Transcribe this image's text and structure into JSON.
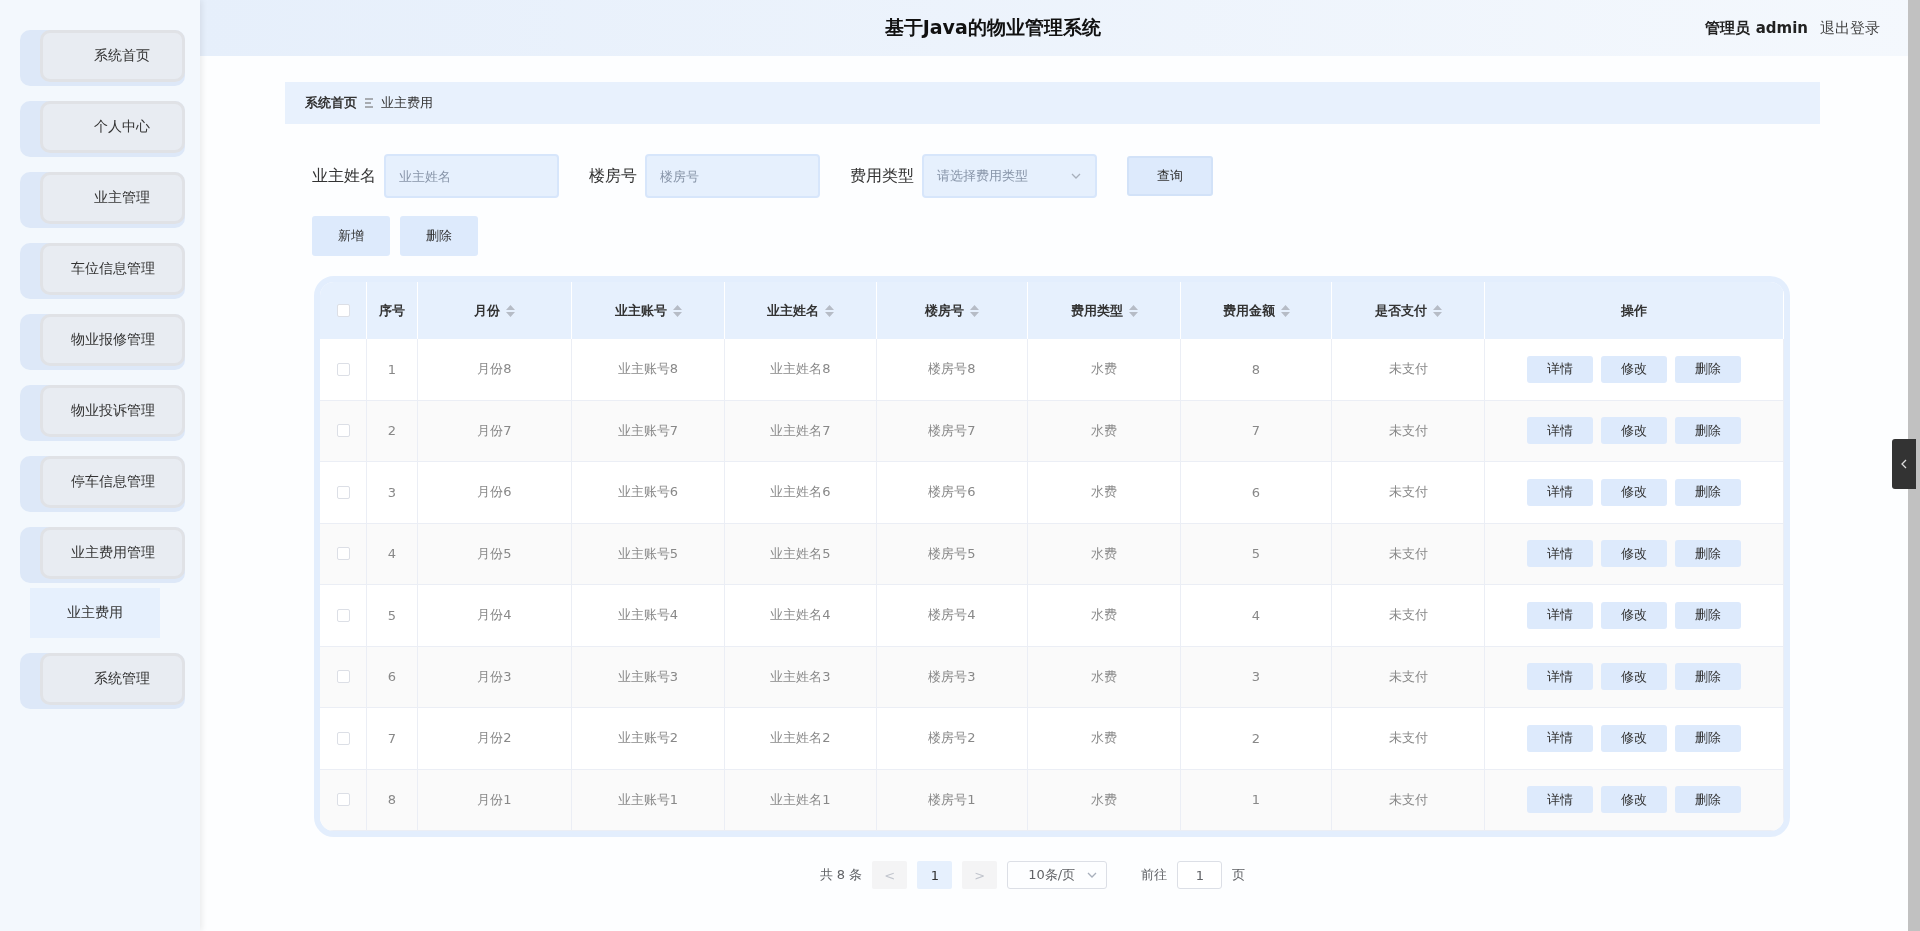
{
  "header": {
    "title": "基于Java的物业管理系统",
    "user": "管理员 admin",
    "logout": "退出登录"
  },
  "sidebar": {
    "items": [
      {
        "label": "系统首页"
      },
      {
        "label": "个人中心"
      },
      {
        "label": "业主管理"
      },
      {
        "label": "车位信息管理"
      },
      {
        "label": "物业报修管理"
      },
      {
        "label": "物业投诉管理"
      },
      {
        "label": "停车信息管理"
      },
      {
        "label": "业主费用管理",
        "children": [
          {
            "label": "业主费用",
            "selected": true
          }
        ]
      },
      {
        "label": "系统管理"
      }
    ]
  },
  "breadcrumb": [
    {
      "label": "系统首页"
    },
    {
      "label": "业主费用"
    }
  ],
  "filters": [
    {
      "kind": "input",
      "label": "业主姓名",
      "placeholder": "业主姓名"
    },
    {
      "kind": "input",
      "label": "楼房号",
      "placeholder": "楼房号"
    },
    {
      "kind": "select",
      "label": "费用类型",
      "placeholder": "请选择费用类型"
    }
  ],
  "search_button": "查询",
  "actions": [
    "新增",
    "删除"
  ],
  "table": {
    "all_checked": false,
    "columns": [
      {
        "label": "序号",
        "sortable": false
      },
      {
        "label": "月份",
        "sortable": true
      },
      {
        "label": "业主账号",
        "sortable": true
      },
      {
        "label": "业主姓名",
        "sortable": true
      },
      {
        "label": "楼房号",
        "sortable": true
      },
      {
        "label": "费用类型",
        "sortable": true
      },
      {
        "label": "费用金额",
        "sortable": true
      },
      {
        "label": "是否支付",
        "sortable": true
      },
      {
        "label": "操作",
        "sortable": false
      }
    ],
    "rows": [
      {
        "checked": false,
        "cells": [
          "1",
          "月份8",
          "业主账号8",
          "业主姓名8",
          "楼房号8",
          "水费",
          "8",
          "未支付"
        ],
        "actions": [
          "详情",
          "修改",
          "删除"
        ]
      },
      {
        "checked": false,
        "cells": [
          "2",
          "月份7",
          "业主账号7",
          "业主姓名7",
          "楼房号7",
          "水费",
          "7",
          "未支付"
        ],
        "actions": [
          "详情",
          "修改",
          "删除"
        ]
      },
      {
        "checked": false,
        "cells": [
          "3",
          "月份6",
          "业主账号6",
          "业主姓名6",
          "楼房号6",
          "水费",
          "6",
          "未支付"
        ],
        "actions": [
          "详情",
          "修改",
          "删除"
        ]
      },
      {
        "checked": false,
        "cells": [
          "4",
          "月份5",
          "业主账号5",
          "业主姓名5",
          "楼房号5",
          "水费",
          "5",
          "未支付"
        ],
        "actions": [
          "详情",
          "修改",
          "删除"
        ]
      },
      {
        "checked": false,
        "cells": [
          "5",
          "月份4",
          "业主账号4",
          "业主姓名4",
          "楼房号4",
          "水费",
          "4",
          "未支付"
        ],
        "actions": [
          "详情",
          "修改",
          "删除"
        ]
      },
      {
        "checked": false,
        "cells": [
          "6",
          "月份3",
          "业主账号3",
          "业主姓名3",
          "楼房号3",
          "水费",
          "3",
          "未支付"
        ],
        "actions": [
          "详情",
          "修改",
          "删除"
        ]
      },
      {
        "checked": false,
        "cells": [
          "7",
          "月份2",
          "业主账号2",
          "业主姓名2",
          "楼房号2",
          "水费",
          "2",
          "未支付"
        ],
        "actions": [
          "详情",
          "修改",
          "删除"
        ]
      },
      {
        "checked": false,
        "cells": [
          "8",
          "月份1",
          "业主账号1",
          "业主姓名1",
          "楼房号1",
          "水费",
          "1",
          "未支付"
        ],
        "actions": [
          "详情",
          "修改",
          "删除"
        ]
      }
    ]
  },
  "pagination": {
    "total": "共 8 条",
    "prev": "<",
    "pages": [
      {
        "label": "1",
        "selected": true
      }
    ],
    "next": ">",
    "page_size": "10条/页",
    "goto_label": "前往",
    "goto_value": "1",
    "page_unit": "页"
  }
}
